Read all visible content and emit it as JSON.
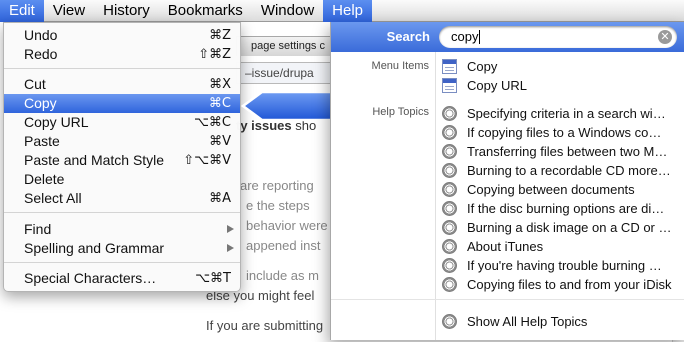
{
  "menubar": {
    "items": [
      {
        "label": "Edit",
        "active": true
      },
      {
        "label": "View",
        "active": false
      },
      {
        "label": "History",
        "active": false
      },
      {
        "label": "Bookmarks",
        "active": false
      },
      {
        "label": "Window",
        "active": false
      },
      {
        "label": "Help",
        "active": true
      }
    ]
  },
  "background_page": {
    "tab_title": "page settings c",
    "url_fragment": "–issue/drupa",
    "heading_bold": "ty issues",
    "heading_tail": " sho",
    "lines": [
      "are reporting",
      "e the steps",
      "behavior were",
      "appened inst",
      "include as m",
      "else you might feel",
      "If you are submitting"
    ]
  },
  "edit_menu": {
    "items": [
      {
        "label": "Undo",
        "shortcut": "⌘Z"
      },
      {
        "label": "Redo",
        "shortcut": "⇧⌘Z"
      },
      {
        "label": "Cut",
        "shortcut": "⌘X"
      },
      {
        "label": "Copy",
        "shortcut": "⌘C",
        "highlighted": true
      },
      {
        "label": "Copy URL",
        "shortcut": "⌥⌘C"
      },
      {
        "label": "Paste",
        "shortcut": "⌘V"
      },
      {
        "label": "Paste and Match Style",
        "shortcut": "⇧⌥⌘V"
      },
      {
        "label": "Delete",
        "shortcut": ""
      },
      {
        "label": "Select All",
        "shortcut": "⌘A"
      },
      {
        "label": "Find",
        "submenu": true
      },
      {
        "label": "Spelling and Grammar",
        "submenu": true
      },
      {
        "label": "Special Characters…",
        "shortcut": "⌥⌘T"
      }
    ]
  },
  "help_search": {
    "label": "Search",
    "query": "copy",
    "clear_icon": "✕",
    "sections": {
      "menu_items_label": "Menu Items",
      "help_topics_label": "Help Topics"
    },
    "menu_items": [
      {
        "label": "Copy",
        "icon": "menu-item-icon"
      },
      {
        "label": "Copy URL",
        "icon": "menu-item-icon"
      }
    ],
    "help_topics": [
      {
        "label": "Specifying criteria in a search wi…",
        "icon": "help-topic-icon"
      },
      {
        "label": "If copying files to a Windows co…",
        "icon": "help-topic-icon"
      },
      {
        "label": "Transferring files between two M…",
        "icon": "help-topic-icon"
      },
      {
        "label": "Burning to a recordable CD more…",
        "icon": "help-topic-icon"
      },
      {
        "label": "Copying between documents",
        "icon": "help-topic-icon"
      },
      {
        "label": "If the disc burning options are di…",
        "icon": "help-topic-icon"
      },
      {
        "label": "Burning a disk image on a CD or …",
        "icon": "help-topic-icon"
      },
      {
        "label": "About iTunes",
        "icon": "help-topic-icon"
      },
      {
        "label": "If you're having trouble burning …",
        "icon": "help-topic-icon"
      },
      {
        "label": "Copying files to and from your iDisk",
        "icon": "help-topic-icon"
      }
    ],
    "show_all": {
      "label": "Show All Help Topics",
      "icon": "help-topic-icon"
    }
  },
  "colors": {
    "selection_blue": "#2f64dc",
    "menu_background": "#fafafa"
  }
}
